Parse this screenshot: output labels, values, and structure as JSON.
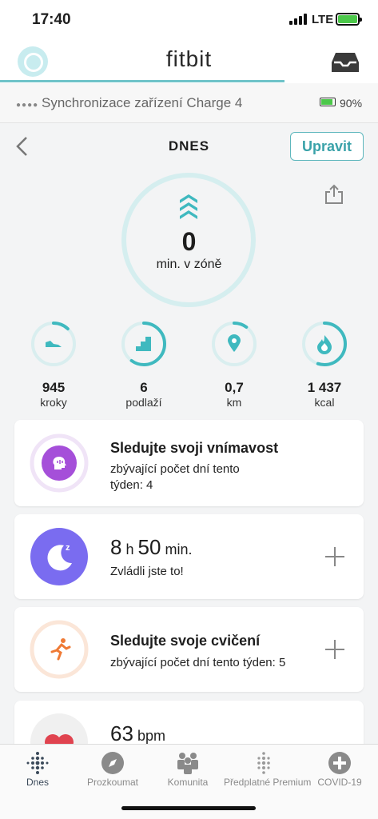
{
  "status": {
    "time": "17:40",
    "network": "LTE"
  },
  "header": {
    "logo": "fitbit"
  },
  "sync": {
    "text": "Synchronizace zařízení Charge 4",
    "battery": "90%",
    "battery_level": 0.9
  },
  "today": {
    "title": "DNES",
    "edit_label": "Upravit"
  },
  "zone": {
    "value": "0",
    "label": "min. v zóně",
    "icon": "active-zone-icon",
    "color": "#3fb9bf"
  },
  "stats": [
    {
      "value": "945",
      "label": "kroky",
      "icon": "shoe-icon",
      "progress": 0.12
    },
    {
      "value": "6",
      "label": "podlaží",
      "icon": "stairs-icon",
      "progress": 0.6
    },
    {
      "value": "0,7",
      "label": "km",
      "icon": "location-pin-icon",
      "progress": 0.1
    },
    {
      "value": "1 437",
      "label": "kcal",
      "icon": "flame-icon",
      "progress": 0.55
    }
  ],
  "cards": {
    "mindfulness": {
      "title": "Sledujte svoji vnímavost",
      "subtitle_line1": "zbývající počet dní tento",
      "subtitle_line2": "týden: 4",
      "color": "#a54fd9"
    },
    "sleep": {
      "hours": "8",
      "h_unit": "h",
      "minutes": "50",
      "min_unit": "min.",
      "subtitle": "Zvládli jste to!",
      "color": "#7a6cf0"
    },
    "exercise": {
      "title": "Sledujte svoje cvičení",
      "subtitle": "zbývající počet dní tento týden: 5",
      "color": "#ef7a35"
    },
    "heart": {
      "value": "63",
      "unit": "bpm",
      "color": "#e0434f"
    }
  },
  "nav": [
    {
      "label": "Dnes",
      "icon": "today-dots-icon",
      "active": true
    },
    {
      "label": "Prozkoumat",
      "icon": "compass-icon",
      "active": false
    },
    {
      "label": "Komunita",
      "icon": "community-icon",
      "active": false
    },
    {
      "label": "Předplatné Premium",
      "icon": "premium-dots-icon",
      "active": false
    },
    {
      "label": "COVID-19",
      "icon": "covid-plus-icon",
      "active": false
    }
  ]
}
